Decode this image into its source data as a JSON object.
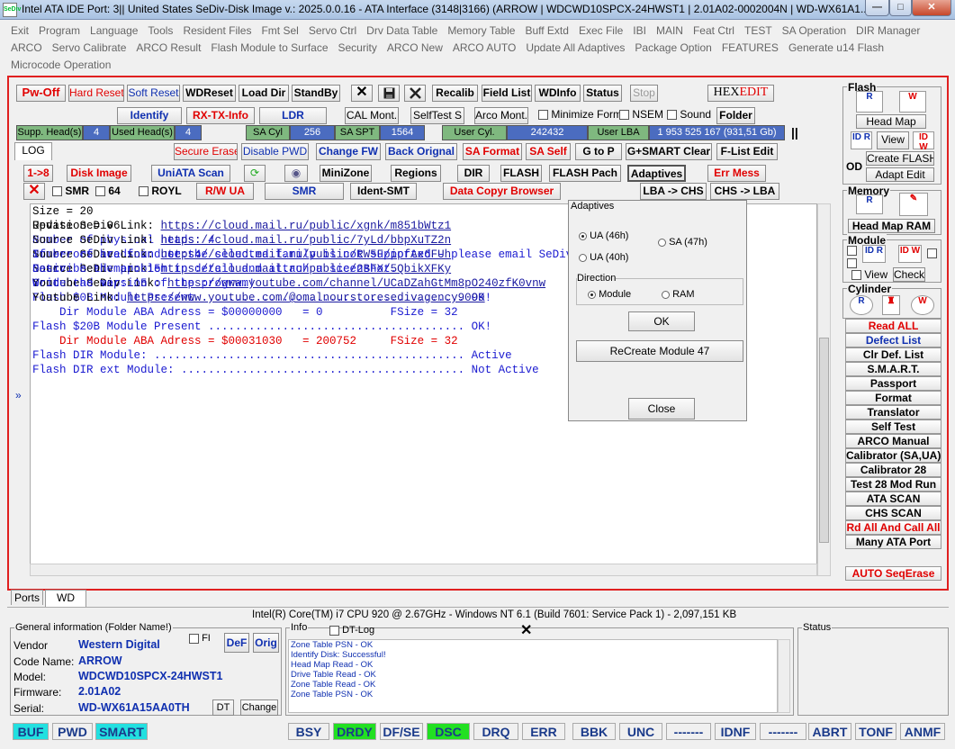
{
  "title": "Intel ATA IDE  Port: 3|| United States  SeDiv-Disk Image v.: 2025.0.0.16 - ATA Interface (3148|3166)  (ARROW | WDCWD10SPCX-24HWST1 | 2.01A02-0002004N | WD-WX61A1...",
  "app_icon": "SeDiv",
  "window": {
    "minimize": "—",
    "maximize": "□",
    "close": "✕"
  },
  "menu": {
    "row1": [
      "Exit",
      "Program",
      "Language",
      "Tools",
      "Resident Files",
      "Fmt Sel",
      "Servo Ctrl",
      "Drv Data Table",
      "Memory Table",
      "Buff Extd",
      "Exec File",
      "IBI",
      "MAIN",
      "Feat Ctrl",
      "TEST",
      "SA Operation",
      "DIR Manager"
    ],
    "row2": [
      "ARCO",
      "Servo Calibrate",
      "ARCO Result",
      "Flash Module to Surface",
      "Security",
      "ARCO New",
      "ARCO AUTO",
      "Update All Adaptives",
      "Package Option",
      "FEATURES",
      "Generate u14 Flash"
    ],
    "row3": [
      "Microcode Operation"
    ]
  },
  "toolbar1": {
    "pwoff": "Pw-Off",
    "hardreset": "Hard Reset",
    "softreset": "Soft Reset",
    "wdreset": "WDReset",
    "loaddir": "Load Dir",
    "standby": "StandBy",
    "recalib": "Recalib",
    "fieldlist": "Field List",
    "wdinfo": "WDInfo",
    "status": "Status",
    "stop": "Stop",
    "hexedit1": "HEX",
    "hexedit2": "EDIT"
  },
  "toolbar2": {
    "identify": "Identify",
    "rxtx": "RX-TX-Info",
    "ldr": "LDR",
    "calmont": "CAL Mont.",
    "selftest": "SelfTest S",
    "arcomont": "Arco Mont.",
    "minform": "Minimize Form",
    "nsem": "NSEM",
    "sound": "Sound",
    "folder": "Folder"
  },
  "heads": {
    "supp_label": "Supp. Head(s)",
    "supp": "4",
    "used_label": "Used Head(s)",
    "used": "4",
    "sacyl_label": "SA Cyl",
    "sacyl": "256",
    "saspt_label": "SA SPT",
    "saspt": "1564",
    "usercyl_label": "User Cyl.",
    "usercyl": "242432",
    "userlba_label": "User LBA",
    "userlba": "1 953 525 167  (931,51 Gb)",
    "pause": "||"
  },
  "toolbar3": {
    "log": "LOG",
    "secureerase": "Secure Erase",
    "disablepwd": "Disable PWD",
    "changefw": "Change FW",
    "backorig": "Back Orignal",
    "saformat": "SA Format",
    "saself": "SA Self",
    "gtop": "G to P",
    "gsmart": "G+SMART Clear",
    "flistedit": "F-List Edit"
  },
  "toolbar4": {
    "one8": "1->8",
    "diskimage": "Disk Image",
    "uniata": "UniATA Scan",
    "minizone": "MiniZone",
    "regions": "Regions",
    "dir": "DIR",
    "flash": "FLASH",
    "flashpach": "FLASH Pach",
    "adaptives": "Adaptives",
    "errmess": "Err Mess"
  },
  "toolbar5": {
    "smr": "SMR",
    "s64": "64",
    "royl": "ROYL",
    "rwua": "R/W UA",
    "smr2": "SMR",
    "identsmt": "Ident-SMT",
    "datacopyr": "Data Copyr Browser",
    "lbachs": "LBA -> CHS",
    "chslba": "CHS -> LBA"
  },
  "log_lines": [
    {
      "t": "Size = 20",
      "c": "#000"
    },
    {
      "t": "Revision = 06",
      "c": "#000"
    },
    {
      "t": "Number of physical heads: 4",
      "c": "#1a1ad0"
    },
    {
      "t": "Number of heads in use: 4",
      "c": "#1a1ad0"
    },
    {
      "t": "Native head map: 15",
      "c": "#1a1ad0"
    },
    {
      "t": "Good head map: 15",
      "c": "#1a1ad0"
    },
    {
      "t": "Flash $0B Module Present ....................................... OK!",
      "c": "#1a1ad0"
    },
    {
      "t": "    Dir Module ABA Adress = $00000000   = 0          FSize = 32",
      "c": "#1a1ad0"
    },
    {
      "t": "Flash $20B Module Present ...................................... OK!",
      "c": "#1a1ad0"
    },
    {
      "t": "    Dir Module ABA Adress = $00031030   = 200752     FSize = 32",
      "c": "#e00000"
    },
    {
      "t": "Flash DIR Module: .............................................. Active",
      "c": "#1a1ad0"
    },
    {
      "t": "Flash DIR ext Module: .......................................... Not Active",
      "c": "#1a1ad0"
    },
    {
      "t": "",
      "c": "#000"
    }
  ],
  "links": [
    {
      "label": "Update SeDiv Link: ",
      "url": "https://cloud.mail.ru/public/xgnk/m851bWtz1"
    },
    {
      "label": "Source SeDiv Link: ",
      "url": "https://cloud.mail.ru/public/7yLd/bbpXuTZ2n"
    },
    {
      "label": "Source SeDiv Link: ",
      "url": "https://cloud.mail.ru/public/RW5F/ipfAx6FUh"
    },
    {
      "label": "Source SeDiv Link: ",
      "url": "https://cloud.mail.ru/public/2BFX/5QbikXFKy"
    },
    {
      "label": "Youtube SeDiv Link: ",
      "url": "https://www.youtube.com/channel/UCaDZahGtMm8pO240zfK0vnw"
    },
    {
      "label": "Youtube Link: ",
      "url": "https://www.youtube.com/@omalnourstoresedivagency9099"
    }
  ],
  "footer_lines": [
    "If errors are found or the selected family is not supported - please email SeDiv@list.ru",
    "Describe the problem in detail and attach a sceenshot.",
    "Write the version of the program!"
  ],
  "dialog": {
    "group": "Adaptives",
    "ua46": "UA (46h)",
    "ua40": "UA (40h)",
    "sa47": "SA (47h)",
    "direction": "Direction",
    "module": "Module",
    "ram": "RAM",
    "ok": "OK",
    "recreate": "ReCreate Module 47",
    "close": "Close"
  },
  "right": {
    "flash": "Flash",
    "headmap": "Head Map",
    "view": "View",
    "createflash": "Create FLASH",
    "adaptedit": "Adapt Edit",
    "od": "OD",
    "memory": "Memory",
    "headmapram": "Head Map RAM",
    "module": "Module",
    "mview": "View",
    "check": "Check",
    "cylinder": "Cylinder",
    "buttons": [
      {
        "t": "Read ALL",
        "c": "#e00000"
      },
      {
        "t": "Defect List",
        "c": "#1030b0"
      },
      {
        "t": "Clr Def. List",
        "c": "#000"
      },
      {
        "t": "S.M.A.R.T.",
        "c": "#000"
      },
      {
        "t": "Passport",
        "c": "#000"
      },
      {
        "t": "Format",
        "c": "#000"
      },
      {
        "t": "Translator",
        "c": "#000"
      },
      {
        "t": "Self Test",
        "c": "#000"
      },
      {
        "t": "ARCO Manual",
        "c": "#000"
      },
      {
        "t": "Calibrator (SA,UA)",
        "c": "#000"
      },
      {
        "t": "Calibrator 28",
        "c": "#000"
      },
      {
        "t": "Test 28 Mod Run",
        "c": "#000"
      },
      {
        "t": "ATA SCAN",
        "c": "#000"
      },
      {
        "t": "CHS SCAN",
        "c": "#000"
      },
      {
        "t": "Rd All And Call All",
        "c": "#e00000"
      },
      {
        "t": "Many ATA Port",
        "c": "#000"
      }
    ],
    "autoseq": "AUTO SeqErase"
  },
  "tabs": [
    "Ports",
    "WD"
  ],
  "cpu": "Intel(R) Core(TM) i7 CPU 920  @ 2.67GHz - Windows NT 6.1 (Build 7601: Service Pack 1) -  2,097,151 KB",
  "general": {
    "title": "General information (Folder Name!)",
    "fi": "FI",
    "def": "DeF",
    "orig": "Orig",
    "vendor_l": "Vendor",
    "vendor": "Western Digital",
    "code_l": "Code Name:",
    "code": "ARROW",
    "model_l": "Model:",
    "model": "WDCWD10SPCX-24HWST1",
    "fw_l": "Firmware:",
    "fw": "2.01A02",
    "serial_l": "Serial:",
    "serial": "WD-WX61A15AA0TH",
    "dt": "DT",
    "change": "Change"
  },
  "info": {
    "title": "Info",
    "dtlog": "DT-Log",
    "lines": [
      "Zone Table PSN - OK",
      "Identify Disk: Successful!",
      "Head Map Read - OK",
      "Drive Table Read - OK",
      "Zone Table Read - OK",
      "Zone Table PSN - OK"
    ]
  },
  "status_title": "Status",
  "status": [
    "BUF",
    "PWD",
    "SMART",
    "BSY",
    "DRDY",
    "DF/SE",
    "DSC",
    "DRQ",
    "ERR",
    "BBK",
    "UNC",
    "-------",
    "IDNF",
    "-------",
    "ABRT",
    "TONF",
    "ANMF"
  ]
}
